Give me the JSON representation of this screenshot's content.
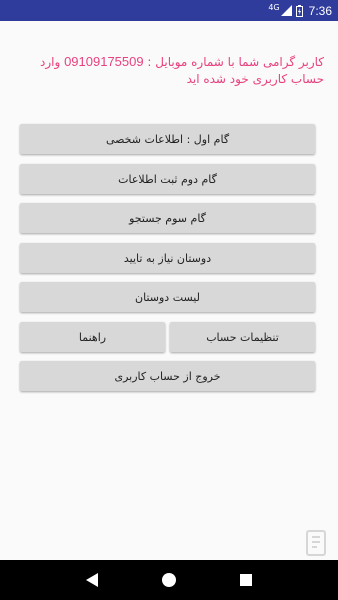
{
  "status_bar": {
    "network": "4G",
    "time": "7:36",
    "bg_color": "#2f3c9c"
  },
  "welcome": {
    "text_before_number": "کاربر گرامی شما با شماره موبایل : ",
    "phone": "09109175509",
    "text_after_number": " وارد حساب کاربری خود شده اید",
    "color": "#e8417e"
  },
  "menu": {
    "step1": "گام اول : اطلاعات شخصی",
    "step2": "گام دوم ثبت اطلاعات",
    "step3": "گام سوم جستجو",
    "pending_friends": "دوستان نیاز به تایید",
    "friends_list": "لیست دوستان",
    "account_settings": "تنظیمات حساب",
    "guide": "راهنما",
    "logout": "خروج از حساب کاربری"
  },
  "nav": {
    "back_icon": "triangle-back-icon",
    "home_icon": "circle-home-icon",
    "recents_icon": "square-recents-icon"
  }
}
